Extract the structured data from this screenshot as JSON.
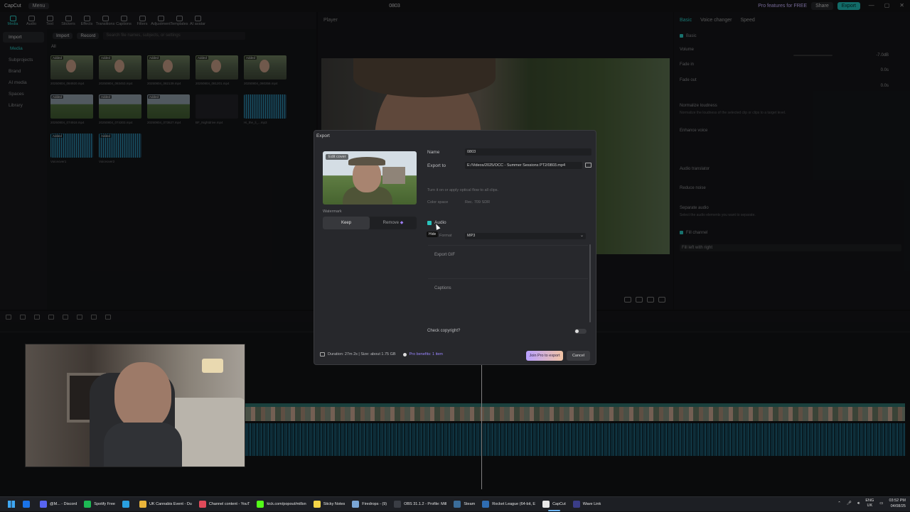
{
  "app": {
    "logo": "CapCut",
    "menu_label": "Menu",
    "window_title": "0803",
    "pro_label": "Pro features for FREE",
    "share_label": "Share",
    "export_label": "Export"
  },
  "toolbar": [
    "Media",
    "Audio",
    "Text",
    "Stickers",
    "Effects",
    "Transitions",
    "Captions",
    "Filters",
    "Adjustment",
    "Templates",
    "AI avatar"
  ],
  "leftnav": [
    "Import",
    "Media",
    "Subprojects",
    "Brand",
    "AI media",
    "Spaces",
    "Library"
  ],
  "media": {
    "import_label": "Import",
    "record_label": "Record",
    "search_placeholder": "Search file names, subjects, or settings",
    "filter_label": "All",
    "thumbs": [
      {
        "tag": "Added",
        "name": "20250804_084920.mp4",
        "style": "face"
      },
      {
        "tag": "Added",
        "name": "20250804_083453.mp4",
        "style": "face"
      },
      {
        "tag": "Added",
        "name": "20250804_082139.mp4",
        "style": "face"
      },
      {
        "tag": "Added",
        "name": "20250804_081201.mp4",
        "style": "face"
      },
      {
        "tag": "Added",
        "name": "20250804_080358.mp4",
        "style": "face"
      },
      {
        "tag": "Added",
        "name": "20250804_074918.mp4",
        "style": "grass"
      },
      {
        "tag": "Added",
        "name": "20250804_074303.mp4",
        "style": "grass"
      },
      {
        "tag": "Added",
        "name": "20250804_073627.mp4",
        "style": "grass"
      },
      {
        "tag": "",
        "name": "BF_Nightdrive.mp4",
        "style": "dark"
      },
      {
        "tag": "",
        "name": "Hi_the_li_...mp3",
        "style": "audio"
      },
      {
        "tag": "Added",
        "name": "Voiceover1",
        "style": "audio"
      },
      {
        "tag": "Added",
        "name": "Voiceover2",
        "style": "audio"
      }
    ]
  },
  "player": {
    "title": "Player"
  },
  "right_panel": {
    "tabs": [
      "Basic",
      "Voice changer",
      "Speed"
    ],
    "basic_label": "Basic",
    "volume_label": "Volume",
    "volume_value": "-7.0dB",
    "fade_in_label": "Fade in",
    "fade_in_value": "0.0s",
    "fade_out_label": "Fade out",
    "fade_out_value": "0.0s",
    "normalize_label": "Normalize loudness",
    "normalize_desc": "Normalize the loudness of the selected clip or clips to a target level.",
    "enhance_label": "Enhance voice",
    "translator_label": "Audio translator",
    "reduce_noise_label": "Reduce noise",
    "separate_label": "Separate audio",
    "separate_desc": "Select the audio elements you want to separate.",
    "fill_channel_label": "Fill channel",
    "fill_channel_value": "Fill left with right"
  },
  "dialog": {
    "title": "Export",
    "edit_cover": "Edit cover",
    "watermark_label": "Watermark",
    "keep_label": "Keep",
    "remove_label": "Remove",
    "name_label": "Name",
    "name_value": "0803",
    "export_to_label": "Export to",
    "export_to_value": "E:/Videos/2025/OCC - Summer Sessions PT2/0803.mp4",
    "optical_hint": "Turn it on or apply optical flow to all clips.",
    "color_space_label": "Color space",
    "color_space_value": "Rec. 709 SDR",
    "audio_label": "Audio",
    "tooltip": "Hide",
    "format_label": "Format",
    "format_value": "MP3",
    "gif_label": "Export GIF",
    "captions_label": "Captions",
    "copyright_label": "Check copyright?",
    "footer_text": "Duration: 27m 2s | Size: about 1.75 GB",
    "pro_benefits": "Pro benefits: 1 item",
    "join_pro_label": "Join Pro to export",
    "cancel_label": "Cancel"
  },
  "taskbar": {
    "items": [
      {
        "label": "@M... - Discord",
        "color": "#5865f2"
      },
      {
        "label": "Spotify Free",
        "color": "#1db954"
      },
      {
        "label": "",
        "color": "#2aa0e0"
      },
      {
        "label": "UK Cannabis Event - Du",
        "color": "#e9b43a"
      },
      {
        "label": "Channel content - YouT",
        "color": "#e04a5a"
      },
      {
        "label": "kick.com/popout/millsn",
        "color": "#53fc18"
      },
      {
        "label": "Sticky Notes",
        "color": "#f5d547"
      },
      {
        "label": "Firedrops - (9)",
        "color": "#7aa6d6"
      },
      {
        "label": "OBS 31.1.2 - Profile: Mill",
        "color": "#3a3d44"
      },
      {
        "label": "Steam",
        "color": "#3b6d9a"
      },
      {
        "label": "Rocket League (64-bit, E",
        "color": "#2f6db3"
      },
      {
        "label": "CapCut",
        "color": "#e8e8e8"
      },
      {
        "label": "Wave Link",
        "color": "#3a3d88"
      }
    ],
    "lang_top": "ENG",
    "lang_bottom": "UK",
    "time": "03:52 PM",
    "date": "04/08/25"
  }
}
